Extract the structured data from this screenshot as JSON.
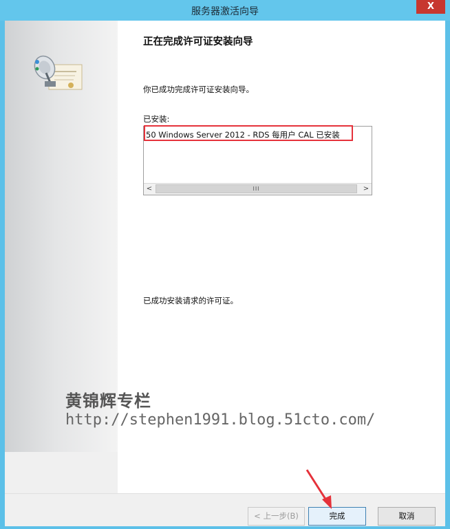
{
  "window": {
    "title": "服务器激活向导",
    "close_glyph": "X"
  },
  "wizard": {
    "heading": "正在完成许可证安装向导",
    "description": "你已成功完成许可证安装向导。",
    "installed_label": "已安装:",
    "installed_items": [
      "50 Windows Server 2012 - RDS 每用户 CAL 已安装"
    ],
    "scroll_thumb_glyph": "III",
    "scroll_left": "<",
    "scroll_right": ">",
    "success_message": "已成功安装请求的许可证。"
  },
  "watermark": {
    "author": "黄锦辉专栏",
    "url": "http://stephen1991.blog.51cto.com/"
  },
  "footer": {
    "back_label": "< 上一步(B)",
    "finish_label": "完成",
    "cancel_label": "取消"
  },
  "colors": {
    "titlebar": "#63c6ec",
    "highlight": "#e5313a",
    "arrow": "#e5313a"
  },
  "icons": {
    "wizard": "satellite-certificate-icon",
    "annotation": "red-arrow-icon"
  }
}
